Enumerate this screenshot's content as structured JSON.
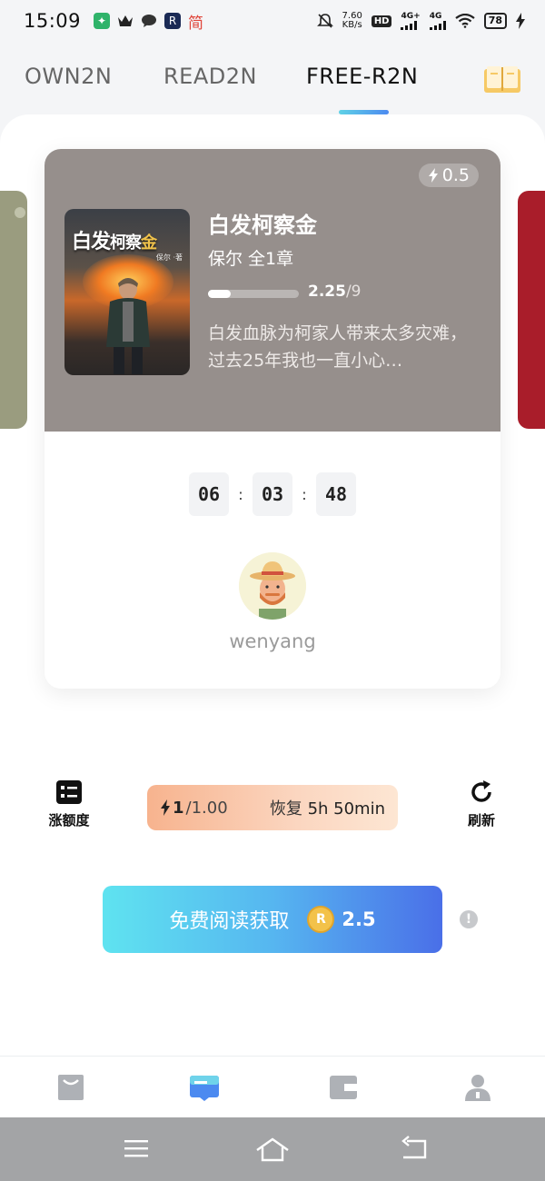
{
  "status_bar": {
    "time": "15:09",
    "left_icons": [
      "app-green-icon",
      "crown-icon",
      "message-icon",
      "app-r-icon",
      "simplified-chinese-icon"
    ],
    "simplified_label": "简",
    "net_speed_value": "7.60",
    "net_speed_unit": "KB/s",
    "hd_label": "HD",
    "signal1_label": "4G+",
    "signal2_label": "4G",
    "battery": "78"
  },
  "top_tabs": {
    "tabs": [
      "OWN2N",
      "READ2N",
      "FREE-R2N"
    ],
    "active_index": 2
  },
  "book_card": {
    "energy_cost": "0.5",
    "cover_title_part1": "白发",
    "cover_title_part2": "柯察",
    "cover_title_part3": "金",
    "cover_author": "保尔 ·著",
    "title": "白发柯察金",
    "meta": "保尔 全1章",
    "progress_current": "2.25",
    "progress_total": "/9",
    "progress_fraction": 0.25,
    "description": "白发血脉为柯家人带来太多灾难，过去25年我也一直小心…",
    "accent_color": "#968f8c"
  },
  "timer": {
    "hours": "06",
    "minutes": "03",
    "seconds": "48",
    "separator": ":"
  },
  "user": {
    "username": "wenyang"
  },
  "controls": {
    "increase_quota_label": "涨额度",
    "refresh_label": "刷新",
    "energy_current": "1",
    "energy_max": "/1.00",
    "recover_label": "恢复",
    "recover_time": "5h 50min"
  },
  "cta": {
    "label": "免费阅读获取",
    "reward": "2.5",
    "coin_symbol": "R"
  },
  "bottom_nav": {
    "items": [
      "shop-icon",
      "read-icon",
      "wallet-icon",
      "profile-icon"
    ],
    "active_index": 1
  }
}
